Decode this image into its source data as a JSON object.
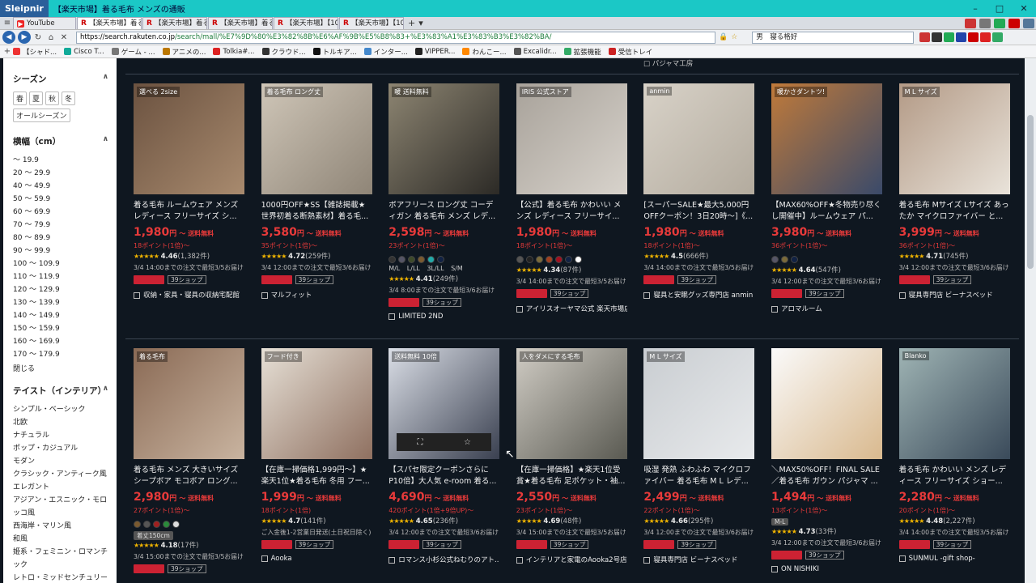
{
  "browser": {
    "brand": "Sleipnir",
    "window_title": "【楽天市場】着る毛布 メンズの通販",
    "tabs": [
      {
        "label": "YouTube",
        "icon": "youtube"
      },
      {
        "label": "【楽天市場】着る...",
        "icon": "rakuten",
        "active": true
      },
      {
        "label": "【楽天市場】着る...",
        "icon": "rakuten"
      },
      {
        "label": "【楽天市場】着る...",
        "icon": "rakuten"
      },
      {
        "label": "【楽天市場】【10...",
        "icon": "rakuten"
      },
      {
        "label": "【楽天市場】【10...",
        "icon": "rakuten"
      }
    ],
    "url_host": "https://search.rakuten.co.jp",
    "url_path": "/search/mall/%E7%9D%80%E3%82%8B%E6%AF%9B%E5%B8%83+%E3%83%A1%E3%83%B3%E3%82%BA/",
    "search_box": "男　寝る格好",
    "bookmarks": [
      "【シャド...",
      "Cisco T...",
      "ゲーム - ...",
      "アニメの...",
      "Tolkia#...",
      "クラウド...",
      "トルキア...",
      "インター...",
      "VIPPER...",
      "わんこー...",
      "Excalidr...",
      "拡張機能",
      "受信トレイ"
    ]
  },
  "sidebar": {
    "season_title": "シーズン",
    "seasons": [
      "春",
      "夏",
      "秋",
      "冬"
    ],
    "season_all": "オールシーズン",
    "width_title": "横幅（cm）",
    "ranges": [
      "〜 19.9",
      "20 〜 29.9",
      "40 〜 49.9",
      "50 〜 59.9",
      "60 〜 69.9",
      "70 〜 79.9",
      "80 〜 89.9",
      "90 〜 99.9",
      "100 〜 109.9",
      "110 〜 119.9",
      "120 〜 129.9",
      "130 〜 139.9",
      "140 〜 149.9",
      "150 〜 159.9",
      "160 〜 169.9",
      "170 〜 179.9"
    ],
    "close_label": "閉じる",
    "taste_title": "テイスト（インテリア）",
    "tastes": [
      "シンプル・ベーシック",
      "北欧",
      "ナチュラル",
      "ポップ・カジュアル",
      "モダン",
      "クラシック・アンティーク風",
      "エレガント",
      "アジアン・エスニック・モロッコ風",
      "西海岸・マリン風",
      "和風",
      "姫系・フェミニン・ロマンチック",
      "レトロ・ミッドセンチュリー"
    ]
  },
  "top_note": "パジャマ工房",
  "common": {
    "yen": "円",
    "shipping": "〜 送料無料",
    "shop_chip": "39ショップ"
  },
  "row1": [
    {
      "name": "着る毛布 ルームウェア メンズ レディース フリーサイズ シ...",
      "price": "1,980",
      "points": "18ポイント(1倍)〜",
      "rating": "4.46",
      "count": "(1,382件)",
      "delivery": "3/4 14:00までの注文で最短3/5お届け",
      "shop": "収納・家具・寝具の収納宅配館",
      "img": "#6b5240",
      "img2": "#a88a6e",
      "label": "選べる 2size"
    },
    {
      "name": "1000円OFF★SS【雑誌掲載★世界初着る断熱素材】着る毛...",
      "price": "3,580",
      "points": "35ポイント(1倍)〜",
      "rating": "4.72",
      "count": "(259件)",
      "delivery": "3/4 12:00までの注文で最短3/6お届け",
      "shop": "マルフィット",
      "img": "#cfc6b8",
      "img2": "#8f8577",
      "label": "着る毛布 ロング丈"
    },
    {
      "name": "ボアフリース ロング丈 コーディガン 着る毛布 メンズ レデ...",
      "price": "2,598",
      "points": "23ポイント(1倍)〜",
      "rating": "4.41",
      "count": "(249件)",
      "delivery": "3/4 8:00までの注文で最短3/6お届け",
      "shop": "LIMITED 2ND",
      "img": "#8d8572",
      "img2": "#2c2a26",
      "label": "暖 送料無料",
      "sizes": "M/L L/LL 3L/LL S/M",
      "swatches": [
        "#333",
        "#556",
        "#3d4a2a",
        "#7a5a30",
        "#2aa",
        "#124"
      ]
    },
    {
      "name": "【公式】着る毛布 かわいい メンズ レディース フリーサイ...",
      "price": "1,980",
      "points": "18ポイント(1倍)〜",
      "rating": "4.34",
      "count": "(87件)",
      "delivery": "3/4 14:00までの注文で最短3/5お届け",
      "shop": "アイリスオーヤマ公式 楽天市場店",
      "img": "#a8a29a",
      "img2": "#d8d3cc",
      "label": "IRIS 公式ストア",
      "swatches": [
        "#555",
        "#222",
        "#7a6a3a",
        "#a04020",
        "#a01020",
        "#124",
        "#fff"
      ]
    },
    {
      "name": "[スーパーSALE★最大5,000円OFFクーポン！3日20時〜]《...",
      "price": "1,980",
      "points": "18ポイント(1倍)〜",
      "rating": "4.5",
      "count": "(666件)",
      "delivery": "3/4 14:00までの注文で最短3/5お届け",
      "shop": "寝具と安眠グッズ専門店 anmin",
      "img": "#d8d2c8",
      "img2": "#b3ab9e",
      "label": "anmin"
    },
    {
      "name": "【MAX60%OFF★冬物売り尽くし開催中】ルームウェア パ...",
      "price": "3,980",
      "points": "36ポイント(1倍)〜",
      "rating": "4.64",
      "count": "(547件)",
      "delivery": "3/4 12:00までの注文で最短3/6お届け",
      "shop": "アロマルーム",
      "img": "#c07a3a",
      "img2": "#3a4a6a",
      "label": "暖かさダントツ!",
      "swatches": [
        "#556",
        "#7a6a3a",
        "#124"
      ]
    },
    {
      "name": "着る毛布 Mサイズ Lサイズ あったか マイクロファイバー と...",
      "price": "3,999",
      "points": "36ポイント(1倍)〜",
      "rating": "4.71",
      "count": "(745件)",
      "delivery": "3/4 12:00までの注文で最短3/6お届け",
      "shop": "寝具専門店 ビーナスベッド",
      "img": "#b39a86",
      "img2": "#e9e3da",
      "label": "M L サイズ"
    }
  ],
  "row2": [
    {
      "name": "着る毛布 メンズ 大きいサイズ シープボア モコボア ロング...",
      "price": "2,980",
      "points": "27ポイント(1倍)〜",
      "rating": "4.18",
      "count": "(17件)",
      "delivery": "3/4 15:00までの注文で最短3/5お届け",
      "shop": "",
      "img": "#8a6a55",
      "img2": "#c9b4a0",
      "label": "着る毛布",
      "swatches": [
        "#7a5a30",
        "#555",
        "#a02020",
        "#2a8a3a",
        "#ddd"
      ],
      "sizechip": "着丈150cm"
    },
    {
      "name": "【在庫一掃価格1,999円〜】★楽天1位★着る毛布 冬用 フー...",
      "price": "1,999",
      "points": "18ポイント(1倍)",
      "rating": "4.7",
      "count": "(141件)",
      "delivery": "ご入金後1-2営業日発送(土日祝日除く)",
      "shop": "Aooka",
      "img": "#e6e0d6",
      "img2": "#8f7060",
      "label": "フード付き"
    },
    {
      "name": "【スパセ限定クーポンさらにP10倍】大人気 e-room 着る...",
      "price": "4,690",
      "points": "420ポイント(1倍+9倍UP)〜",
      "rating": "4.65",
      "count": "(236件)",
      "delivery": "3/4 12:00までの注文で最短3/6お届け",
      "shop": "ロマンス小杉公式ねむりのアト...",
      "img": "#dadee6",
      "img2": "#3a4050",
      "label": "送料無料 10倍",
      "overlay": true
    },
    {
      "name": "【在庫一掃価格】★楽天1位受賞★着る毛布 足ポケット・袖...",
      "price": "2,550",
      "points": "23ポイント(1倍)〜",
      "rating": "4.69",
      "count": "(48件)",
      "delivery": "3/4 15:00までの注文で最短3/5お届け",
      "shop": "インテリアと家電のAooka2号店",
      "img": "#d0ccc4",
      "img2": "#5a5a52",
      "label": "人をダメにする毛布"
    },
    {
      "name": "吸湿 発熱 ふわふわ マイクロファイバー 着る毛布 M L レデ...",
      "price": "2,499",
      "points": "22ポイント(1倍)〜",
      "rating": "4.66",
      "count": "(295件)",
      "delivery": "3/4 12:00までの注文で最短3/6お届け",
      "shop": "寝具専門店 ビーナスベッド",
      "img": "#c9cdd1",
      "img2": "#e8eaec",
      "label": "M L サイズ"
    },
    {
      "name": "＼MAX50%OFF！FINAL SALE／着る毛布 ガウン パジャマ ...",
      "price": "1,494",
      "points": "13ポイント(1倍)〜",
      "rating": "4.73",
      "count": "(33件)",
      "delivery": "3/4 12:00までの注文で最短3/6お届け",
      "shop": "ON NISHIKI",
      "img": "#fafafa",
      "img2": "#d9b98e",
      "label": "",
      "sizechip": "M-L"
    },
    {
      "name": "着る毛布 かわいい メンズ レディース フリーサイズ ショー...",
      "price": "2,280",
      "points": "20ポイント(1倍)〜",
      "rating": "4.48",
      "count": "(2,227件)",
      "delivery": "3/4 14:00までの注文で最短3/5お届け",
      "shop": "SUNMUL -gift shop-",
      "img": "#9fb4b4",
      "img2": "#3a4a5a",
      "label": "Blanko"
    }
  ]
}
